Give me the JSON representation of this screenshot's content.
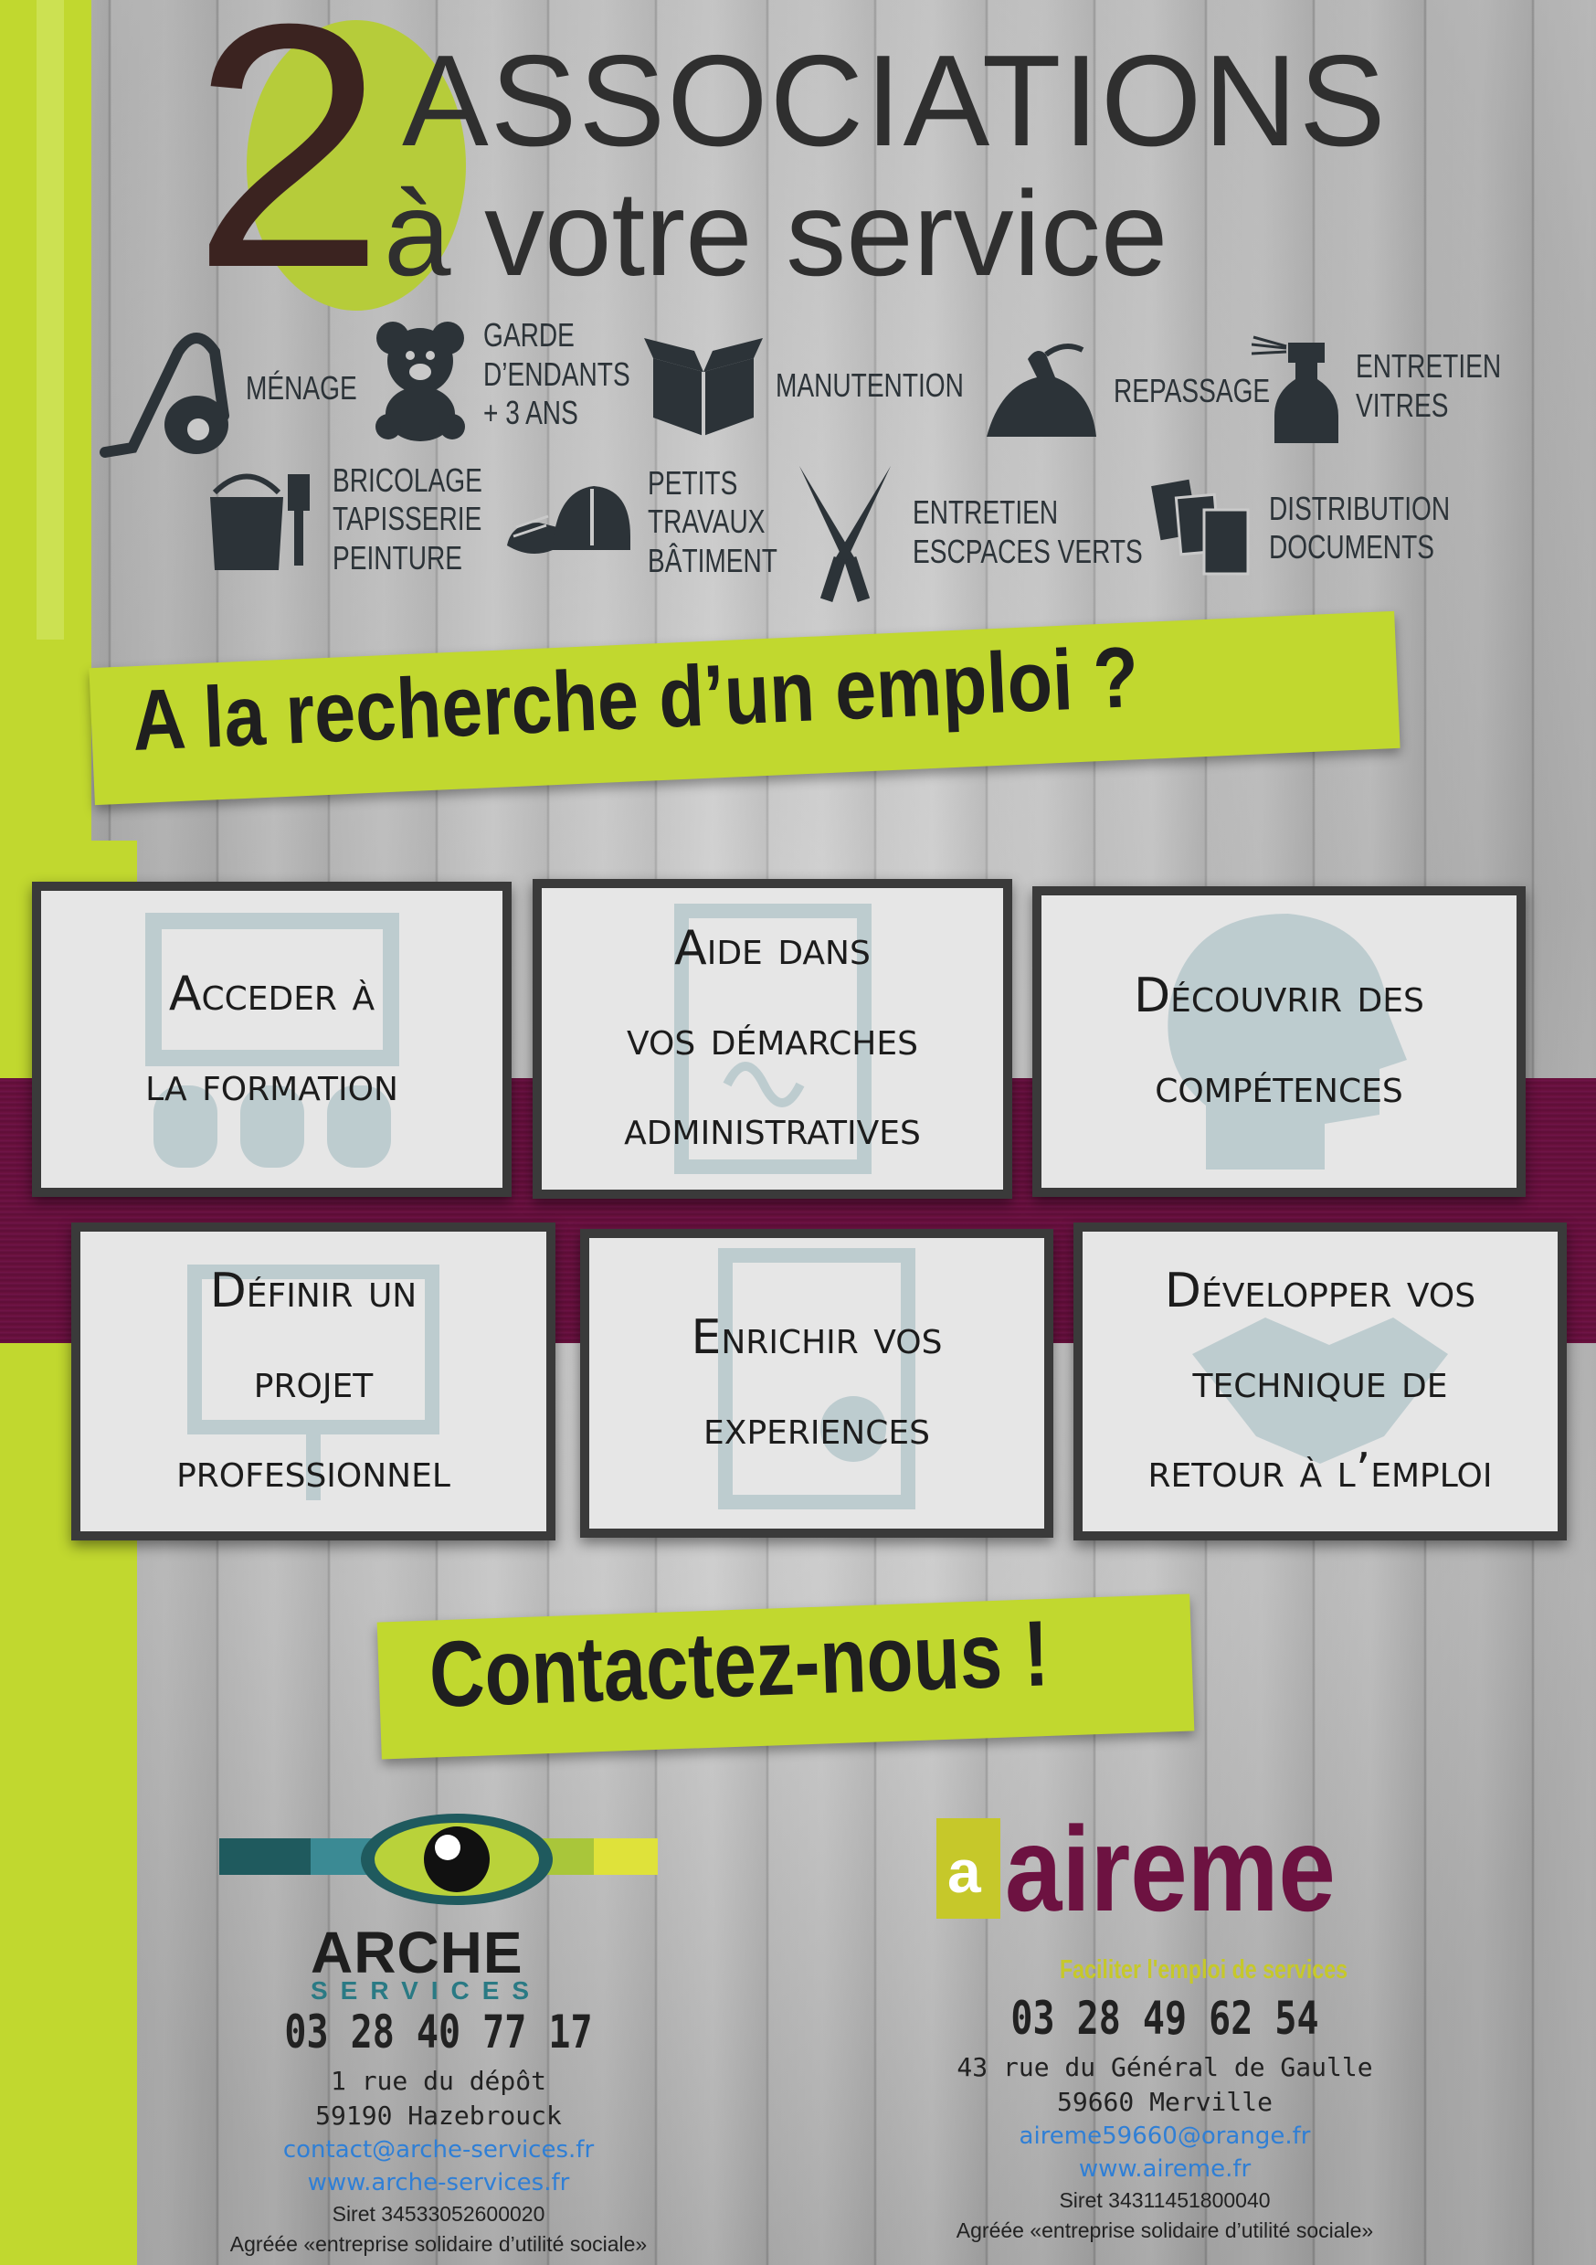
{
  "title": {
    "number": "2",
    "line1": "ASSOCIATIONS",
    "line2": "à votre service"
  },
  "services": [
    {
      "icon": "vacuum-icon",
      "label": "MÉNAGE"
    },
    {
      "icon": "teddy-bear-icon",
      "label": "GARDE\nD’ENDANTS\n+ 3 ANS"
    },
    {
      "icon": "box-icon",
      "label": "MANUTENTION"
    },
    {
      "icon": "iron-icon",
      "label": "REPASSAGE"
    },
    {
      "icon": "spray-bottle-icon",
      "label": "ENTRETIEN\nVITRES"
    },
    {
      "icon": "paint-bucket-icon",
      "label": "BRICOLAGE\nTAPISSERIE\nPEINTURE"
    },
    {
      "icon": "helmet-gloves-icon",
      "label": "PETITS\nTRAVAUX\nBÂTIMENT"
    },
    {
      "icon": "shears-icon",
      "label": "ENTRETIEN\nESCPACES VERTS"
    },
    {
      "icon": "documents-icon",
      "label": "DISTRIBUTION\nDOCUMENTS"
    }
  ],
  "headline": "A la recherche d’un emploi ?",
  "cards": [
    {
      "text": "Acceder à\nla formation"
    },
    {
      "text": "Aide dans\nvos démarches\nadministratives"
    },
    {
      "text": "Découvrir des\ncompétences"
    },
    {
      "text": "Définir un\nprojet\nprofessionnel"
    },
    {
      "text": "Enrichir vos\nexperiences"
    },
    {
      "text": "Développer vos\ntechnique de\nretour à l’emploi"
    }
  ],
  "contact_title": "Contactez-nous !",
  "arche": {
    "logo_name": "ARCHE",
    "logo_sub": "SERVICES",
    "phone": "03 28 40 77 17",
    "address1": "1 rue du dépôt",
    "address2": "59190 Hazebrouck",
    "email": "contact@arche-services.fr",
    "web": "www.arche-services.fr",
    "siret": "Siret 34533052600020",
    "agree": "Agréée «entreprise solidaire d’utilité sociale»"
  },
  "aireme": {
    "logo_name": "aireme",
    "tagline": "Faciliter l'emploi de services",
    "phone": "03 28 49 62 54",
    "address1": "43 rue du Général de Gaulle",
    "address2": "59660 Merville",
    "email": "aireme59660@orange.fr",
    "web": "www.aireme.fr",
    "siret": "Siret 34311451800040",
    "agree": "Agréée «entreprise solidaire d’utilité sociale»"
  },
  "colors": {
    "green": "#c1d82f",
    "plum": "#6d1241",
    "dark": "#3a3a3a",
    "link": "#2f7fd6"
  }
}
